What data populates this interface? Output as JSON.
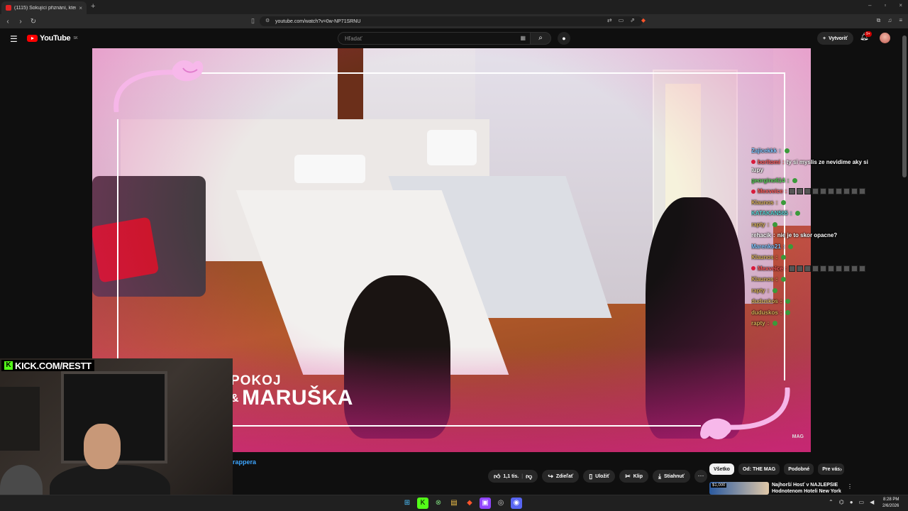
{
  "browser": {
    "tab_title": "(1115) Šokující přiznání, které",
    "new_tab": "+",
    "url": "youtube.com/watch?v=0w-NP71SRNU"
  },
  "youtube": {
    "logo_text": "YouTube",
    "region": "SK",
    "search_placeholder": "Hľadať",
    "create_label": "Vytvoriť",
    "notifications_badge": "9+"
  },
  "video": {
    "room_label": "POKOJ",
    "room_name": "MARUŠKA",
    "room_name_prefix": "&",
    "watermark": "MAG",
    "stream_banner": "KICK.COM/RESTT"
  },
  "chat": [
    {
      "user": "Zajicekkk",
      "color": "#7fc6ff",
      "msg": ""
    },
    {
      "user": "borltomi",
      "color": "#ff5a5a",
      "msg": "ty si myslis ze nevidime aky si tupy"
    },
    {
      "user": "georgino614",
      "color": "#5ad35a",
      "msg": ""
    },
    {
      "user": "Mexveice",
      "color": "#ff5a5a",
      "msg": ""
    },
    {
      "user": "Klaunos",
      "color": "#d9b25a",
      "msg": ""
    },
    {
      "user": "KATAKAN565",
      "color": "#5ad3d3",
      "msg": ""
    },
    {
      "user": "rapty",
      "color": "#d9b25a",
      "msg": ""
    },
    {
      "user": "rehacik",
      "color": "#ffffff",
      "msg": "nie je to skor opacne?"
    },
    {
      "user": "Marenko21",
      "color": "#7fc6ff",
      "msg": ""
    },
    {
      "user": "Klaunos",
      "color": "#d9b25a",
      "msg": ""
    },
    {
      "user": "Mexveice",
      "color": "#ff5a5a",
      "msg": ""
    },
    {
      "user": "Klaunos",
      "color": "#d9b25a",
      "msg": ""
    },
    {
      "user": "rapty",
      "color": "#d9b25a",
      "msg": ""
    },
    {
      "user": "duduskos",
      "color": "#d9b25a",
      "msg": ""
    },
    {
      "user": "duduskos",
      "color": "#d9b25a",
      "msg": ""
    },
    {
      "user": "rapty",
      "color": "#d9b25a",
      "msg": ""
    }
  ],
  "below_player": {
    "channel": "rappera",
    "likes": "1,1 tis.",
    "share": "Zdieľať",
    "save": "Uložiť",
    "clip": "Klip",
    "download": "Stiahnuť"
  },
  "chips": [
    "Všetko",
    "Od: THE MAG",
    "Podobné",
    "Pre vás"
  ],
  "recommendation": {
    "thumb_badge": "$1,000",
    "title": "Najhorší Hosť v NAJLEPŠIE Hodnotenom Hoteli New York"
  },
  "taskbar": {
    "time": "8:28 PM",
    "date": "2/6/2026"
  },
  "icons": [
    "back-icon",
    "forward-icon",
    "reload-icon",
    "bookmark-icon",
    "menu-icon",
    "search-icon",
    "mic-icon",
    "plus-icon",
    "bell-icon",
    "like-icon",
    "dislike-icon",
    "share-icon",
    "save-icon",
    "scissors-icon",
    "download-icon",
    "more-icon",
    "chevron-right-icon"
  ]
}
